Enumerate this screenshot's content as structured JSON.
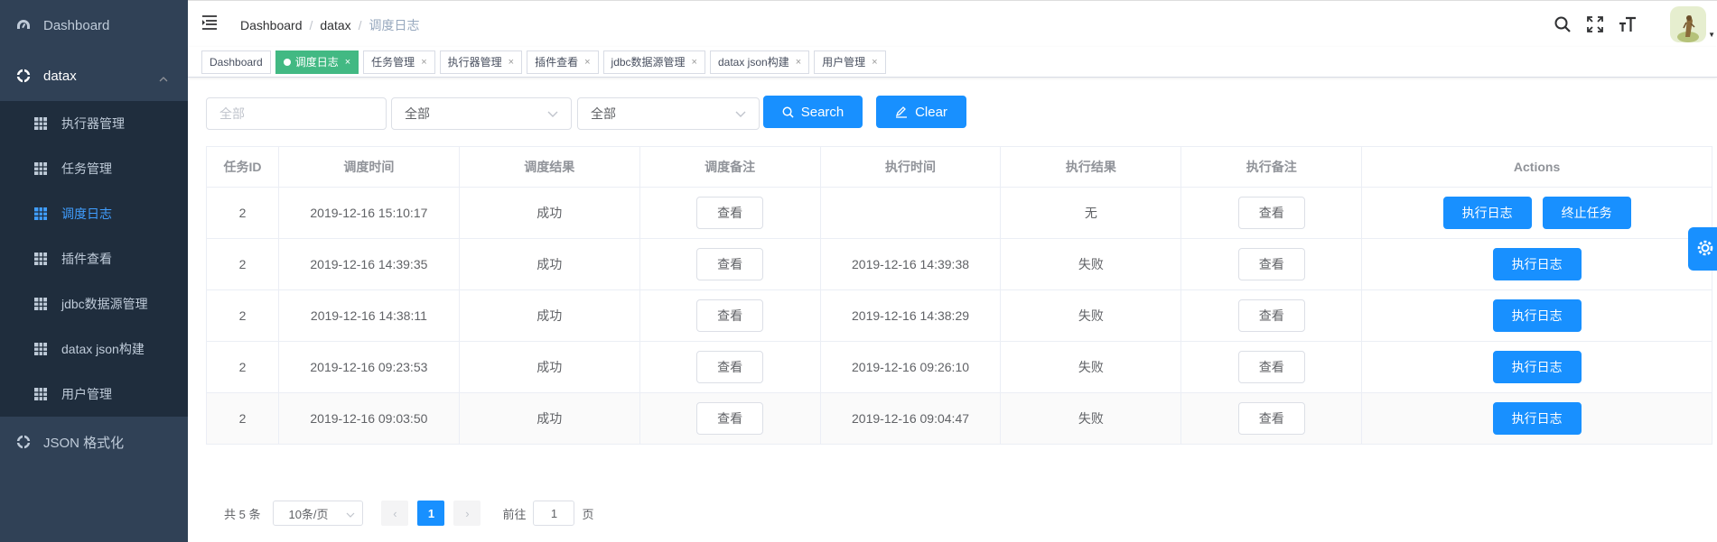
{
  "sidebar": {
    "dashboard_label": "Dashboard",
    "datax_label": "datax",
    "items": [
      {
        "label": "执行器管理",
        "active": false
      },
      {
        "label": "任务管理",
        "active": false
      },
      {
        "label": "调度日志",
        "active": true
      },
      {
        "label": "插件查看",
        "active": false
      },
      {
        "label": "jdbc数据源管理",
        "active": false
      },
      {
        "label": "datax json构建",
        "active": false
      },
      {
        "label": "用户管理",
        "active": false
      }
    ],
    "json_label": "JSON 格式化"
  },
  "navbar": {
    "breadcrumb": [
      "Dashboard",
      "datax",
      "调度日志"
    ],
    "separator": "/"
  },
  "tags": [
    {
      "label": "Dashboard",
      "active": false,
      "closable": false
    },
    {
      "label": "调度日志",
      "active": true,
      "closable": true
    },
    {
      "label": "任务管理",
      "active": false,
      "closable": true
    },
    {
      "label": "执行器管理",
      "active": false,
      "closable": true
    },
    {
      "label": "插件查看",
      "active": false,
      "closable": true
    },
    {
      "label": "jdbc数据源管理",
      "active": false,
      "closable": true
    },
    {
      "label": "datax json构建",
      "active": false,
      "closable": true
    },
    {
      "label": "用户管理",
      "active": false,
      "closable": true
    }
  ],
  "tag_close": "×",
  "filter": {
    "input_placeholder": "全部",
    "select1_value": "全部",
    "select2_value": "全部",
    "search_label": "Search",
    "clear_label": "Clear"
  },
  "table": {
    "headers": [
      "任务ID",
      "调度时间",
      "调度结果",
      "调度备注",
      "执行时间",
      "执行结果",
      "执行备注",
      "Actions"
    ],
    "view_label": "查看",
    "log_label": "执行日志",
    "stop_label": "终止任务",
    "rows": [
      {
        "id": "2",
        "trigger_time": "2019-12-16 15:10:17",
        "trigger_result": "成功",
        "exec_time": "",
        "exec_result": "无",
        "can_stop": true
      },
      {
        "id": "2",
        "trigger_time": "2019-12-16 14:39:35",
        "trigger_result": "成功",
        "exec_time": "2019-12-16 14:39:38",
        "exec_result": "失败",
        "can_stop": false
      },
      {
        "id": "2",
        "trigger_time": "2019-12-16 14:38:11",
        "trigger_result": "成功",
        "exec_time": "2019-12-16 14:38:29",
        "exec_result": "失败",
        "can_stop": false
      },
      {
        "id": "2",
        "trigger_time": "2019-12-16 09:23:53",
        "trigger_result": "成功",
        "exec_time": "2019-12-16 09:26:10",
        "exec_result": "失败",
        "can_stop": false
      },
      {
        "id": "2",
        "trigger_time": "2019-12-16 09:03:50",
        "trigger_result": "成功",
        "exec_time": "2019-12-16 09:04:47",
        "exec_result": "失败",
        "can_stop": false
      }
    ]
  },
  "pagination": {
    "total_text": "共 5 条",
    "page_size": "10条/页",
    "current_page": "1",
    "goto_prefix": "前往",
    "goto_value": "1",
    "goto_suffix": "页",
    "prev": "‹",
    "next": "›"
  },
  "colors": {
    "sidebar_bg": "#304156",
    "submenu_bg": "#1f2d3d",
    "primary": "#1890ff",
    "active_tag": "#42b983",
    "active_menu": "#409eff"
  },
  "icons": {
    "dashboard": "dashboard-icon",
    "datax": "component-icon",
    "submenu": "table-icon",
    "json": "component-icon",
    "search": "search-icon",
    "fullscreen": "fullscreen-icon",
    "size": "font-size-icon",
    "settings": "gear-icon"
  }
}
